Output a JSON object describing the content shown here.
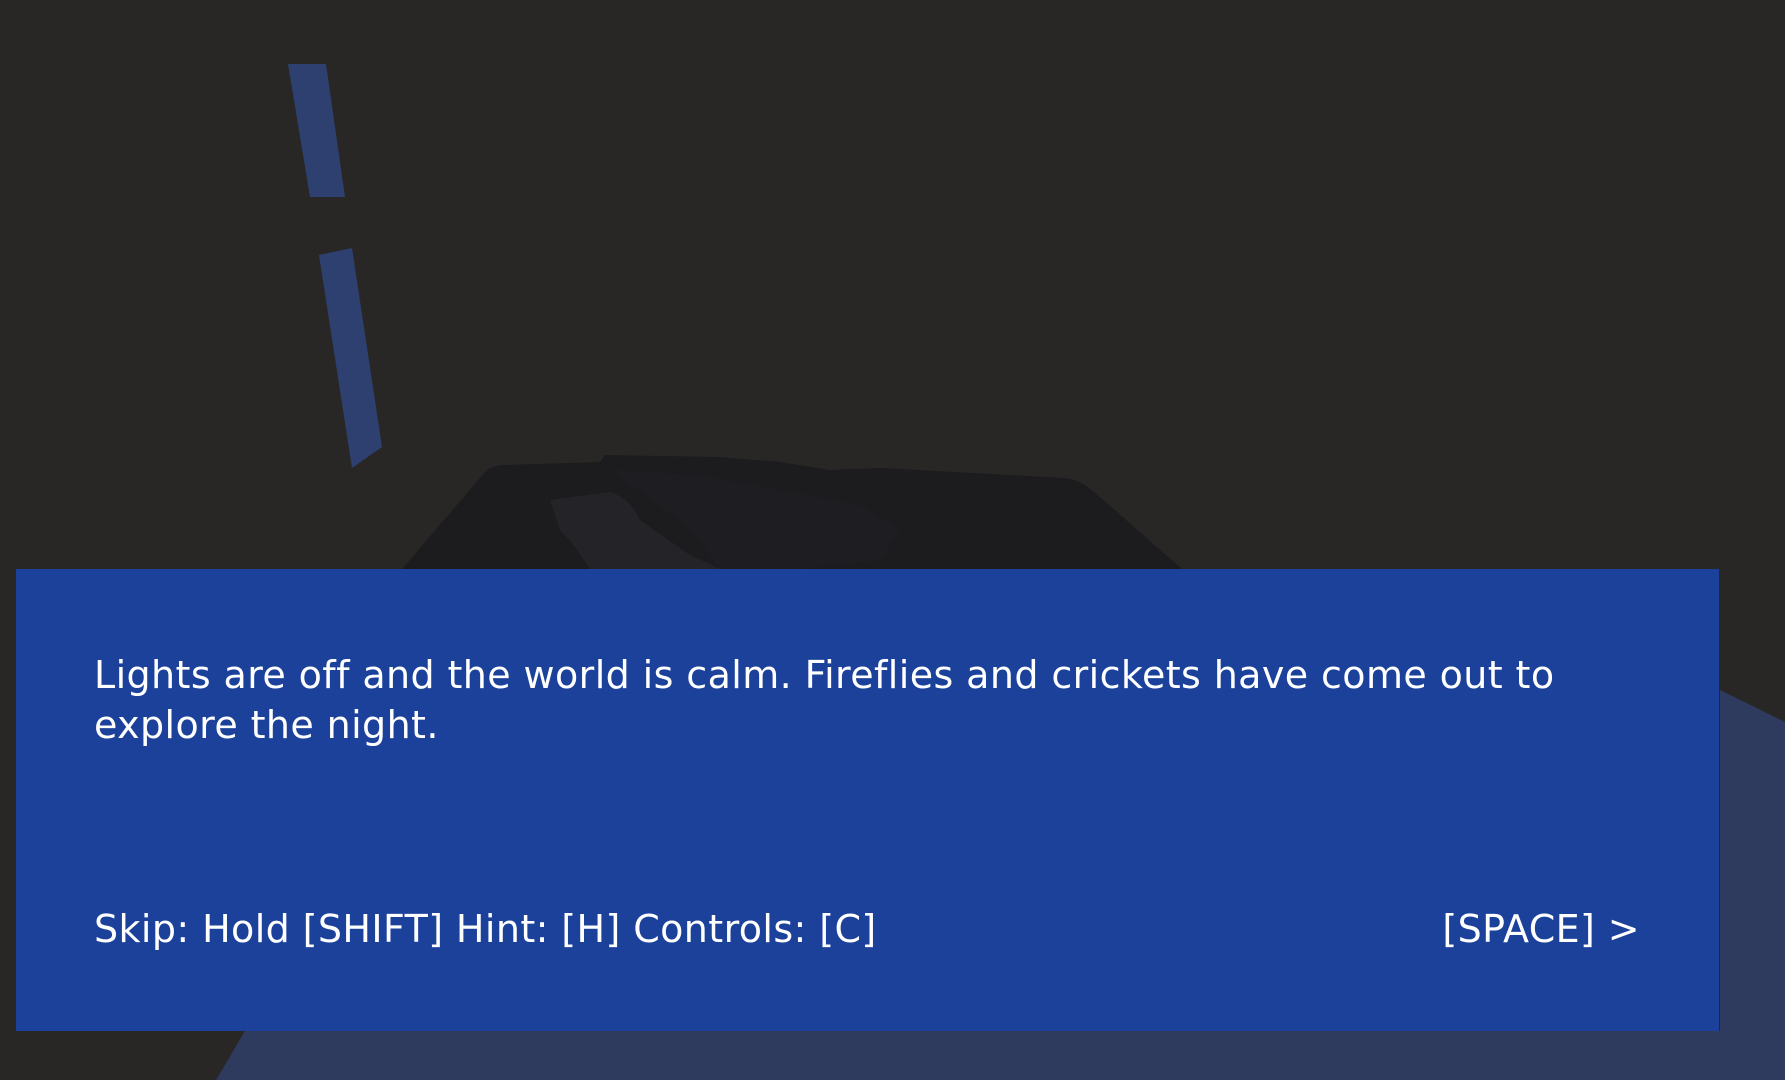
{
  "dialog": {
    "narration": "Lights are off and the world is calm. Fireflies and crickets have come out to explore the night.",
    "controls_hint": "Skip: Hold [SHIFT] Hint: [H] Controls: [C]",
    "continue_prompt": "[SPACE] >"
  },
  "colors": {
    "background": "#282726",
    "dialog_box": "#1b419b",
    "floor": "#2e3b5e",
    "accent_beam": "#2e4070",
    "silhouette": "#1c1c1f"
  }
}
